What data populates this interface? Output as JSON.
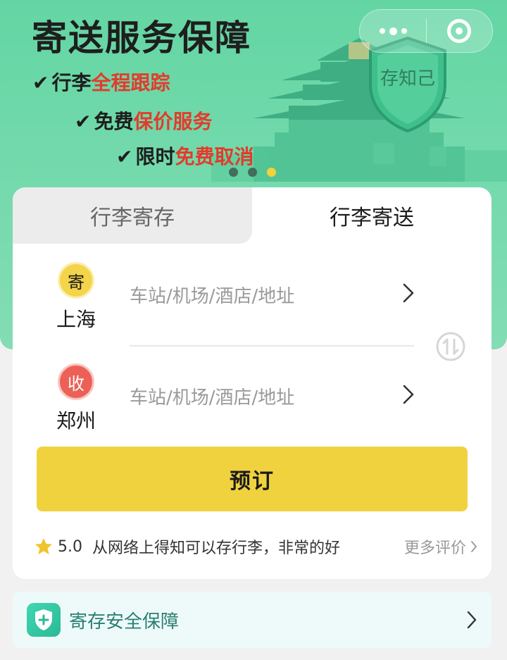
{
  "banner": {
    "title": "寄送服务保障",
    "features": [
      {
        "prefix": "行李",
        "highlight": "全程跟踪"
      },
      {
        "prefix": "免费",
        "highlight": "保价服务"
      },
      {
        "prefix": "限时",
        "highlight": "免费取消"
      }
    ],
    "shield_label": "存知己",
    "carousel": {
      "count": 3,
      "active_index": 3
    }
  },
  "capsule": {
    "more_icon": "more-dots-icon",
    "close_icon": "target-close-icon"
  },
  "tabs": [
    {
      "label": "行李寄存",
      "active": false
    },
    {
      "label": "行李寄送",
      "active": true
    }
  ],
  "route": {
    "from": {
      "badge": "寄",
      "city": "上海",
      "placeholder": "车站/机场/酒店/地址"
    },
    "to": {
      "badge": "收",
      "city": "郑州",
      "placeholder": "车站/机场/酒店/地址"
    },
    "swap_icon": "swap-icon"
  },
  "book_button": "预订",
  "review": {
    "rating": "5.0",
    "text": "从网络上得知可以存行李，非常的好",
    "more_label": "更多评价"
  },
  "guarantee": {
    "label": "寄存安全保障"
  },
  "colors": {
    "banner_green": "#71d9ab",
    "accent_yellow": "#f0d23f",
    "highlight_red": "#e33b2b",
    "receive_red": "#ec6157"
  }
}
